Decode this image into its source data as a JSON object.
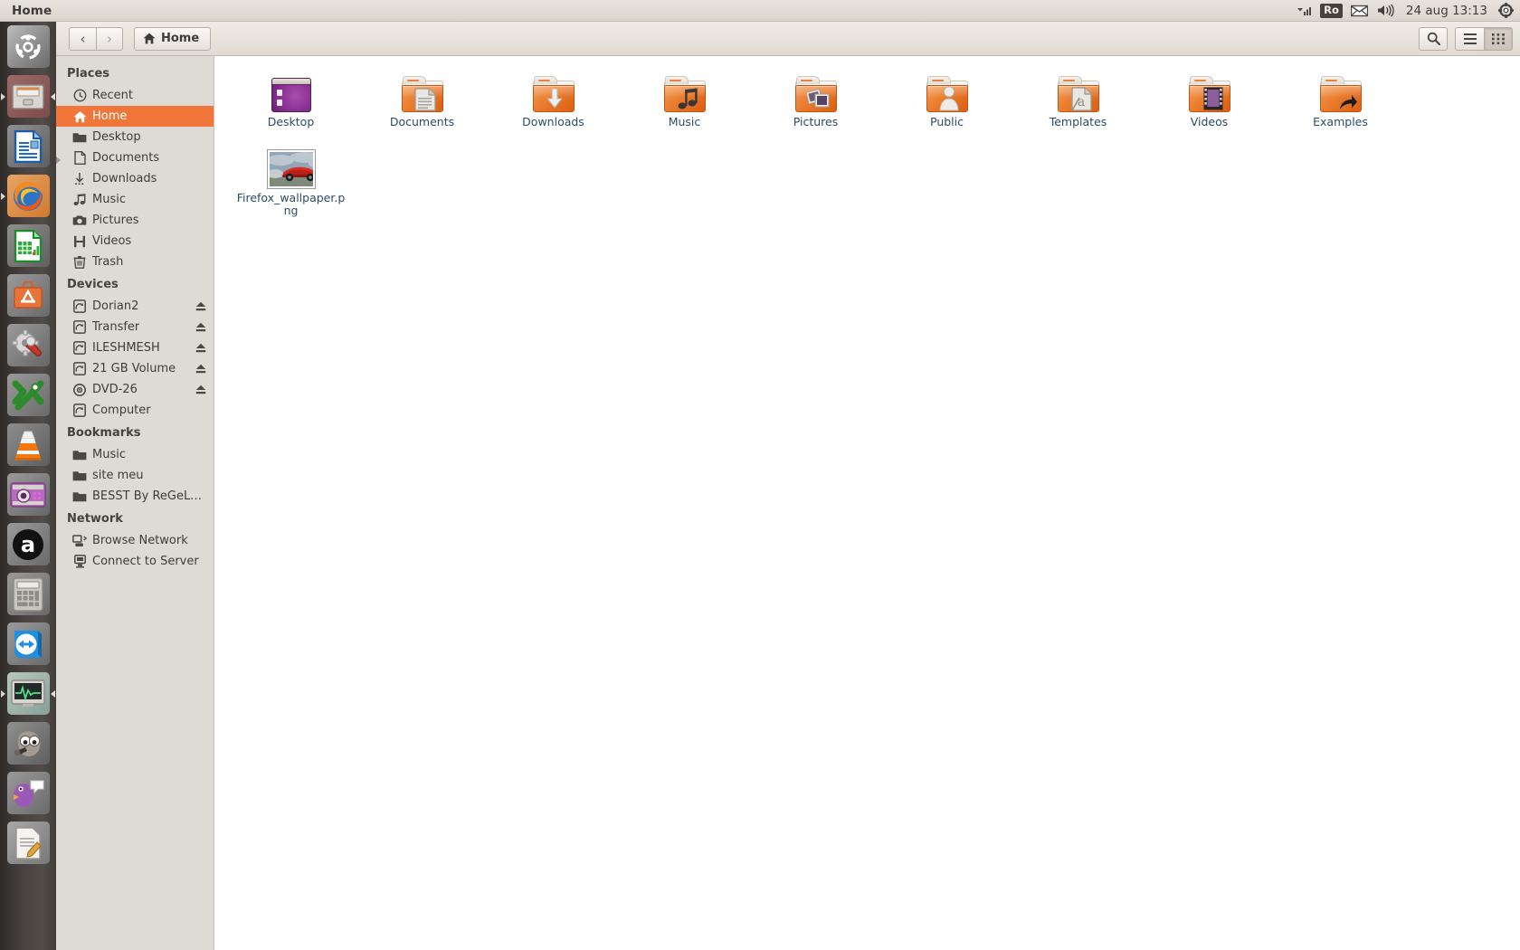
{
  "panel": {
    "title": "Home",
    "tray": {
      "keyboard_layout": "Ro",
      "clock": "24 aug 13:13",
      "icons": [
        "wifi-signal-icon",
        "keyboard-layout-indicator",
        "envelope-icon",
        "volume-icon",
        "system-menu-gear-icon"
      ]
    }
  },
  "launcher": {
    "items": [
      {
        "name": "ubuntu-dash-icon",
        "label": "Ubuntu Dash",
        "running": false,
        "focused": false
      },
      {
        "name": "files-nautilus-icon",
        "label": "Files",
        "running": true,
        "focused": true
      },
      {
        "name": "libreoffice-writer-icon",
        "label": "LibreOffice Writer",
        "running": false,
        "focused": false
      },
      {
        "name": "firefox-icon",
        "label": "Firefox",
        "running": true,
        "focused": false
      },
      {
        "name": "libreoffice-calc-icon",
        "label": "LibreOffice Calc",
        "running": false,
        "focused": false
      },
      {
        "name": "ubuntu-software-icon",
        "label": "Ubuntu Software",
        "running": false,
        "focused": false
      },
      {
        "name": "system-settings-icon",
        "label": "System Settings",
        "running": false,
        "focused": false
      },
      {
        "name": "xchat-icon",
        "label": "XChat",
        "running": false,
        "focused": false
      },
      {
        "name": "vlc-icon",
        "label": "VLC Media Player",
        "running": false,
        "focused": false
      },
      {
        "name": "cheese-webcam-icon",
        "label": "Cheese",
        "running": false,
        "focused": false
      },
      {
        "name": "amazon-icon",
        "label": "Amazon",
        "running": false,
        "focused": false
      },
      {
        "name": "calculator-icon",
        "label": "Calculator",
        "running": false,
        "focused": false
      },
      {
        "name": "teamviewer-icon",
        "label": "TeamViewer",
        "running": false,
        "focused": false
      },
      {
        "name": "system-monitor-icon",
        "label": "System Monitor",
        "running": true,
        "focused": true
      },
      {
        "name": "gimp-icon",
        "label": "GIMP",
        "running": false,
        "focused": false
      },
      {
        "name": "pidgin-icon",
        "label": "Pidgin",
        "running": false,
        "focused": false
      },
      {
        "name": "text-editor-icon",
        "label": "Text Editor",
        "running": false,
        "focused": false
      }
    ]
  },
  "toolbar": {
    "back_label": "‹",
    "forward_label": "›",
    "path_label": "Home",
    "search_label": "search-icon",
    "list_view_label": "list-view-icon",
    "grid_view_label": "grid-view-icon"
  },
  "sidebar": {
    "sections": [
      {
        "heading": "Places",
        "items": [
          {
            "label": "Recent",
            "icon": "clock-icon",
            "selected": false,
            "eject": false
          },
          {
            "label": "Home",
            "icon": "home-icon",
            "selected": true,
            "eject": false
          },
          {
            "label": "Desktop",
            "icon": "folder-icon",
            "selected": false,
            "eject": false
          },
          {
            "label": "Documents",
            "icon": "document-icon",
            "selected": false,
            "eject": false
          },
          {
            "label": "Downloads",
            "icon": "download-icon",
            "selected": false,
            "eject": false
          },
          {
            "label": "Music",
            "icon": "music-note-icon",
            "selected": false,
            "eject": false
          },
          {
            "label": "Pictures",
            "icon": "camera-icon",
            "selected": false,
            "eject": false
          },
          {
            "label": "Videos",
            "icon": "film-icon",
            "selected": false,
            "eject": false
          },
          {
            "label": "Trash",
            "icon": "trash-icon",
            "selected": false,
            "eject": false
          }
        ]
      },
      {
        "heading": "Devices",
        "items": [
          {
            "label": "Dorian2",
            "icon": "drive-icon",
            "selected": false,
            "eject": true
          },
          {
            "label": "Transfer",
            "icon": "drive-icon",
            "selected": false,
            "eject": true
          },
          {
            "label": "ILESHMESH",
            "icon": "drive-icon",
            "selected": false,
            "eject": true
          },
          {
            "label": "21 GB Volume",
            "icon": "drive-icon",
            "selected": false,
            "eject": true
          },
          {
            "label": "DVD-26",
            "icon": "optical-disc-icon",
            "selected": false,
            "eject": true
          },
          {
            "label": "Computer",
            "icon": "drive-icon",
            "selected": false,
            "eject": false
          }
        ]
      },
      {
        "heading": "Bookmarks",
        "items": [
          {
            "label": "Music",
            "icon": "folder-icon",
            "selected": false,
            "eject": false
          },
          {
            "label": "site meu",
            "icon": "folder-icon",
            "selected": false,
            "eject": false
          },
          {
            "label": "BESST By ReGeLe (…",
            "icon": "folder-icon",
            "selected": false,
            "eject": false
          }
        ]
      },
      {
        "heading": "Network",
        "items": [
          {
            "label": "Browse Network",
            "icon": "network-icon",
            "selected": false,
            "eject": false
          },
          {
            "label": "Connect to Server",
            "icon": "server-icon",
            "selected": false,
            "eject": false
          }
        ]
      }
    ]
  },
  "files": {
    "items": [
      {
        "label": "Desktop",
        "kind": "desktop"
      },
      {
        "label": "Documents",
        "kind": "folder-documents"
      },
      {
        "label": "Downloads",
        "kind": "folder-downloads"
      },
      {
        "label": "Music",
        "kind": "folder-music"
      },
      {
        "label": "Pictures",
        "kind": "folder-pictures"
      },
      {
        "label": "Public",
        "kind": "folder-public"
      },
      {
        "label": "Templates",
        "kind": "folder-templates"
      },
      {
        "label": "Videos",
        "kind": "folder-videos"
      },
      {
        "label": "Examples",
        "kind": "folder-symlink"
      },
      {
        "label": "Firefox_wallpaper.png",
        "kind": "image-thumbnail"
      }
    ]
  },
  "colors": {
    "accent_orange": "#f0763a",
    "folder_orange": "#ea7c2c",
    "panel_bg": "#e2dbd4",
    "sidebar_bg": "#dedad6",
    "label_blue": "#2e4b66"
  }
}
